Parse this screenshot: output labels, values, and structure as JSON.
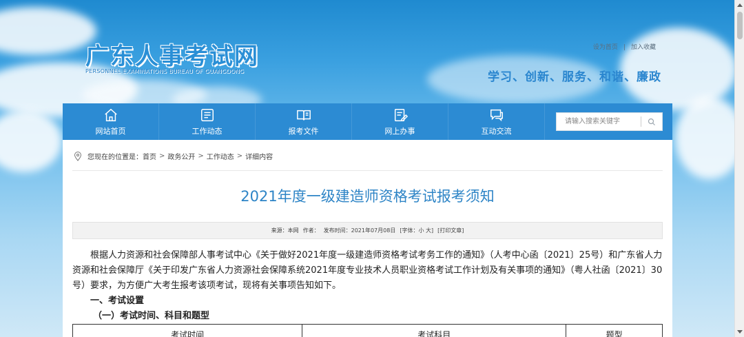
{
  "header": {
    "site_title": "广东人事考试网",
    "site_subtitle": "PERSONNEL EXAMINATIONS BUREAU OF GUANGDONG",
    "set_home_label": "设为首页",
    "link_separator": "|",
    "add_favorite_label": "加入收藏",
    "slogan": "学习、创新、服务、和谐、廉政"
  },
  "nav": {
    "items": [
      {
        "label": "网站首页",
        "icon": "home-icon"
      },
      {
        "label": "工作动态",
        "icon": "news-icon"
      },
      {
        "label": "报考文件",
        "icon": "book-icon"
      },
      {
        "label": "网上办事",
        "icon": "edit-document-icon"
      },
      {
        "label": "互动交流",
        "icon": "chat-icon"
      }
    ],
    "search_placeholder": "请输入搜索关键字"
  },
  "breadcrumb": {
    "prefix": "您现在的位置是：",
    "items": [
      "首页",
      "政务公开",
      "工作动态",
      "详细内容"
    ],
    "separator": ">"
  },
  "article": {
    "title": "2021年度一级建造师资格考试报考须知",
    "meta": {
      "source": "来源：本网",
      "author": "作者：",
      "published": "发布时间：2021年07月08日",
      "font_size": "[字体：小 大]",
      "print": "[打印文章]"
    },
    "paragraph_1": "根据人力资源和社会保障部人事考试中心《关于做好2021年度一级建造师资格考试考务工作的通知》（人考中心函〔2021〕25号）和广东省人力资源和社会保障厅《关于印发广东省人力资源社会保障系统2021年度专业技术人员职业资格考试工作计划及有关事项的通知》（粤人社函〔2021〕30号）要求，为方便广大考生报考该项考试，现将有关事项告知如下。",
    "section_1": "一、考试设置",
    "subsection_1": "（一）考试时间、科目和题型",
    "table_headers": [
      "考试时间",
      "考试科目",
      "题型"
    ]
  },
  "colors": {
    "nav_bg": "#2c8bd3",
    "title_blue": "#2d84c6",
    "brand_blue": "#2a8fd6"
  }
}
